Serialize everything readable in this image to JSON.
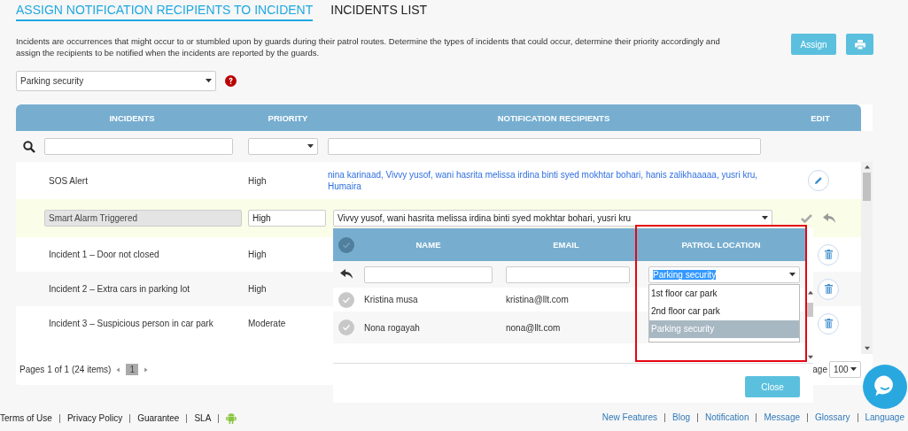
{
  "tabs": [
    {
      "label": "ASSIGN NOTIFICATION RECIPIENTS TO INCIDENT",
      "selected": true
    },
    {
      "label": "INCIDENTS LIST",
      "selected": false
    }
  ],
  "description": "Incidents are occurrences that might occur to or stumbled upon by guards during their patrol routes. Determine the types of incidents that could occur, determine their priority accordingly and assign the recipients to be notified when the incidents are reported by the guards.",
  "assign_button": "Assign",
  "location_select": {
    "value": "Parking security"
  },
  "table": {
    "columns": [
      "INCIDENTS",
      "PRIORITY",
      "NOTIFICATION RECIPIENTS",
      "EDIT"
    ],
    "rows": [
      {
        "kind": "view",
        "incident": "SOS Alert",
        "priority": "High",
        "recipients": "nina karinaad, Vivvy yusof, wani hasrita melissa irdina binti syed mokhtar bohari, hanis zalikhaaaaa, yusri kru, Humaira",
        "action": {
          "kind": "edit"
        }
      },
      {
        "kind": "edit",
        "incident": "Smart Alarm Triggered",
        "priority": "High",
        "recipients": "Vivvy yusof, wani hasrita melissa irdina binti syed mokhtar bohari, yusri kru"
      },
      {
        "kind": "view",
        "incident": "Incident 1 – Door not closed",
        "priority": "High",
        "action": {
          "kind": "delete"
        }
      },
      {
        "kind": "view",
        "incident": "Incident 2 – Extra cars in parking lot",
        "priority": "High",
        "action": {
          "kind": "delete"
        }
      },
      {
        "kind": "view",
        "incident": "Incident 3 – Suspicious person in car park",
        "priority": "Moderate",
        "action": {
          "kind": "delete"
        }
      }
    ]
  },
  "pager": {
    "summary": "Pages 1 of 1 (24 items)",
    "page": "1",
    "page_size_label": "age",
    "page_size": "100"
  },
  "recipients_popup": {
    "columns": [
      "NAME",
      "EMAIL",
      "PATROL LOCATION"
    ],
    "all_checked": false,
    "location_filter": "Parking security",
    "location_options": [
      {
        "label": "1st floor car park",
        "selected": false
      },
      {
        "label": "2nd floor car park",
        "selected": false
      },
      {
        "label": "Parking security",
        "selected": true
      }
    ],
    "rows": [
      {
        "name": "Kristina musa",
        "email": "kristina@llt.com",
        "checked": false
      },
      {
        "name": "Nona rogayah",
        "email": "nona@llt.com",
        "checked": false
      }
    ],
    "close_button": "Close"
  },
  "footer": {
    "left": [
      "Terms of Use",
      "Privacy Policy",
      "Guarantee",
      "SLA"
    ],
    "right": [
      "New Features",
      "Blog",
      "Notification",
      "Message",
      "Glossary",
      "Language"
    ]
  }
}
